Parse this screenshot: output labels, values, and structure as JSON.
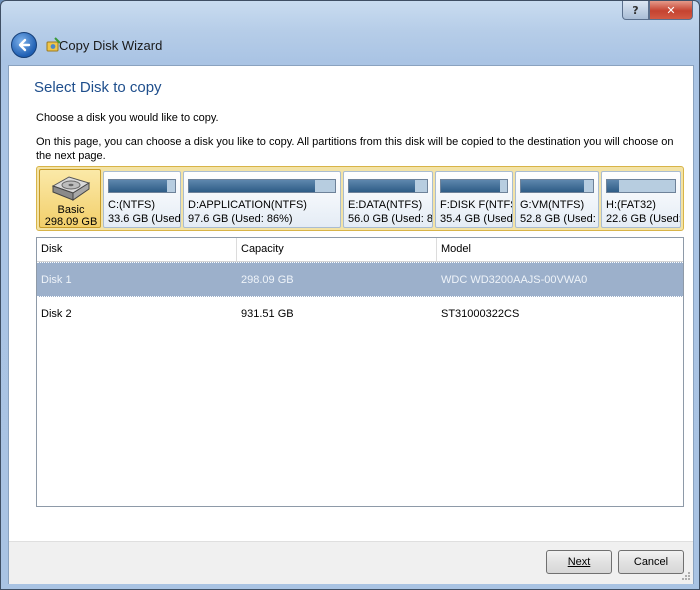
{
  "window": {
    "title": "Copy Disk Wizard",
    "help_label": "?",
    "close_label": "✕"
  },
  "page": {
    "heading": "Select Disk to copy",
    "subtitle": "Choose a disk you would like to copy.",
    "description": "On this page, you can choose a disk you like to copy. All partitions from this disk will be copied to the destination you will choose on the next page."
  },
  "disk_map": {
    "disk": {
      "type": "Basic",
      "size": "298.09 GB"
    },
    "partitions": [
      {
        "name": "C:(NTFS)",
        "info": "33.6 GB (Used: ...",
        "used_fraction": 0.88
      },
      {
        "name": "D:APPLICATION(NTFS)",
        "info": "97.6 GB (Used: 86%)",
        "used_fraction": 0.86
      },
      {
        "name": "E:DATA(NTFS)",
        "info": "56.0 GB (Used: 8...",
        "used_fraction": 0.85
      },
      {
        "name": "F:DISK F(NTFS)",
        "info": "35.4 GB (Used: ...",
        "used_fraction": 0.9
      },
      {
        "name": "G:VM(NTFS)",
        "info": "52.8 GB (Used: ...",
        "used_fraction": 0.88
      },
      {
        "name": "H:(FAT32)",
        "info": "22.6 GB (Used: ...",
        "used_fraction": 0.18
      }
    ]
  },
  "table": {
    "columns": [
      "Disk",
      "Capacity",
      "Model"
    ],
    "rows": [
      {
        "disk": "Disk 1",
        "capacity": "298.09 GB",
        "model": "WDC WD3200AAJS-00VWA0",
        "selected": true
      },
      {
        "disk": "Disk 2",
        "capacity": "931.51 GB",
        "model": "ST31000322CS",
        "selected": false
      }
    ]
  },
  "buttons": {
    "next": "Next",
    "cancel": "Cancel"
  },
  "colors": {
    "accent": "#1e4e8c",
    "selected_row": "#9cb0cb",
    "disk_map_bg": "#f3e3a6"
  }
}
